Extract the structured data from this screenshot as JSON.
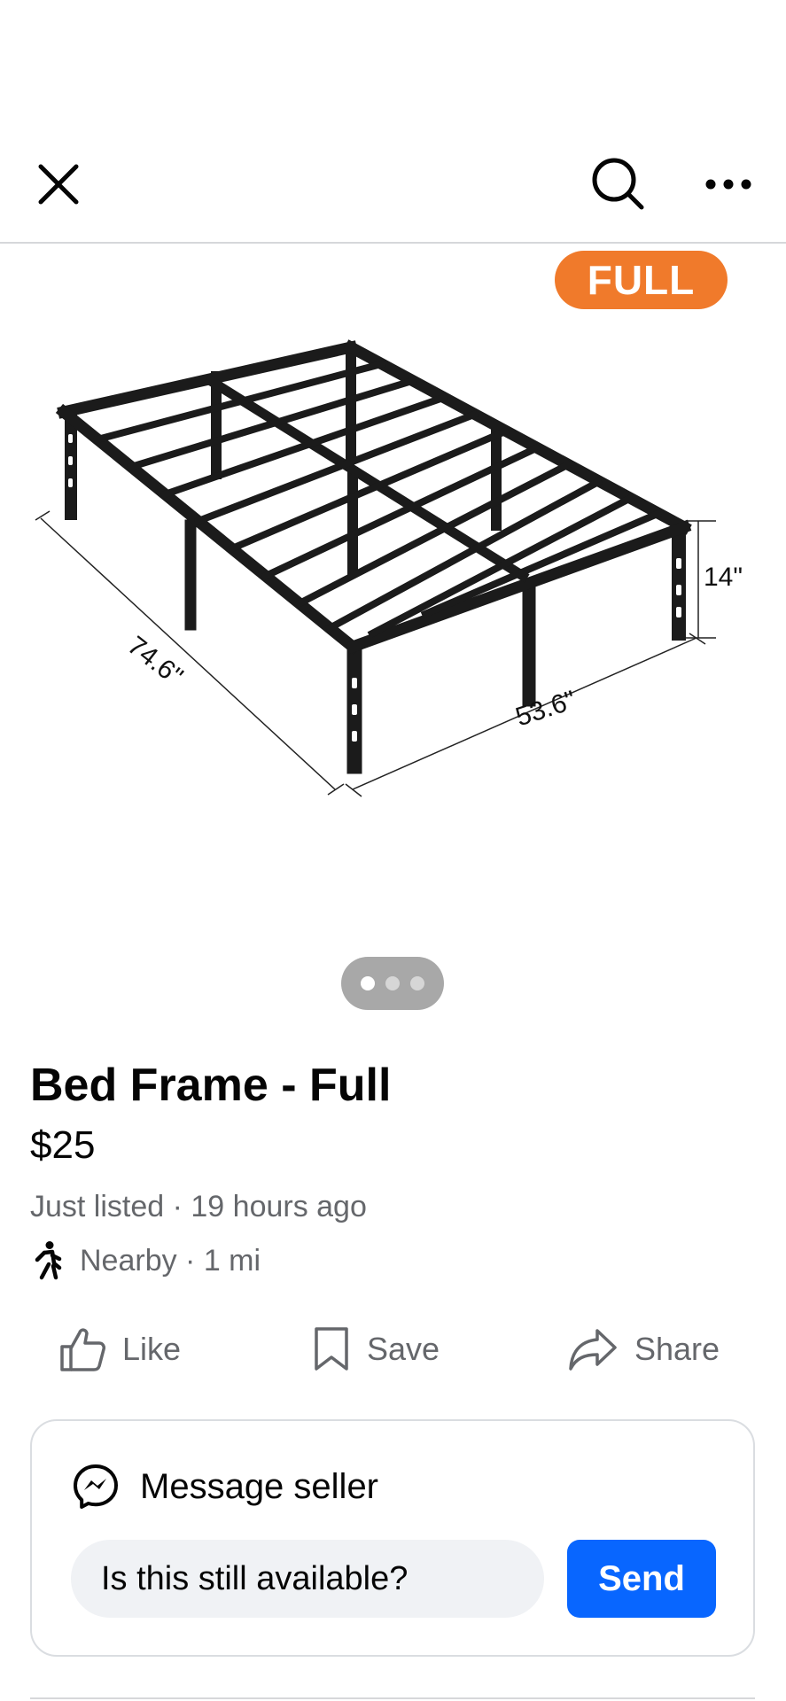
{
  "header": {
    "close_icon": "close-icon",
    "search_icon": "search-icon",
    "more_icon": "more-options-icon"
  },
  "image": {
    "badge": "FULL",
    "dim_length": "74.6\"",
    "dim_width": "53.6\"",
    "dim_height": "14\"",
    "carousel": {
      "count": 3,
      "active_index": 0
    }
  },
  "listing": {
    "title": "Bed Frame - Full",
    "price": "$25",
    "meta": "Just listed · 19 hours ago",
    "location": "Nearby · 1 mi"
  },
  "actions": {
    "like": "Like",
    "save": "Save",
    "share": "Share"
  },
  "message": {
    "title": "Message seller",
    "input_value": "Is this still available?",
    "send": "Send"
  },
  "colors": {
    "accent": "#0866ff",
    "badge": "#f07a2b",
    "secondary_text": "#65676b"
  }
}
